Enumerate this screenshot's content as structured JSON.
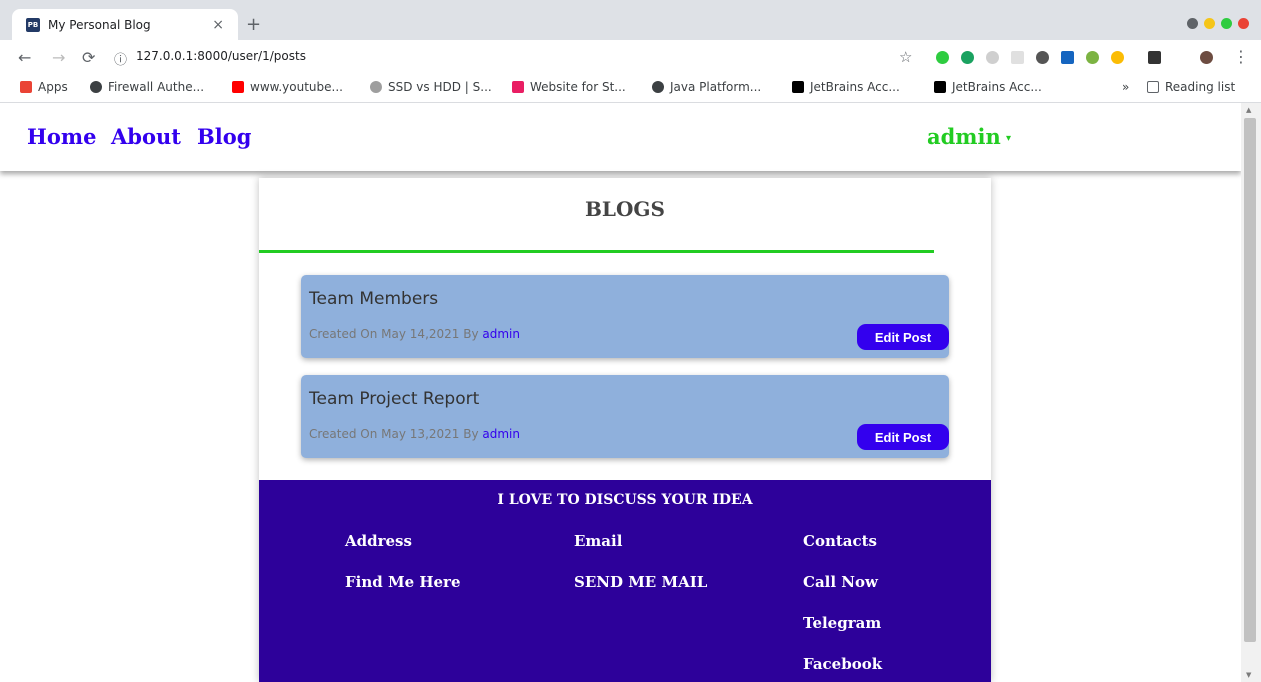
{
  "browser": {
    "tab_title": "My Personal Blog",
    "tab_favicon_text": "PB",
    "tab_close": "×",
    "new_tab": "+",
    "url": "127.0.0.1:8000/user/1/posts",
    "bookmarks": [
      "Apps",
      "Firewall Authe...",
      "www.youtube...",
      "SSD vs HDD | S...",
      "Website for St...",
      "Java Platform...",
      "JetBrains Acc...",
      "JetBrains Acc..."
    ],
    "bookmarks_more": "»",
    "reading_list": "Reading list"
  },
  "nav": {
    "home": "Home",
    "about": "About",
    "blog": "Blog",
    "user": "admin",
    "caret": "▾"
  },
  "main": {
    "title": "BLOGS",
    "posts": [
      {
        "title": "Team Members",
        "meta": "Created On May 14,2021 By ",
        "author": "admin",
        "edit_label": "Edit Post"
      },
      {
        "title": "Team Project Report",
        "meta": "Created On May 13,2021 By ",
        "author": "admin",
        "edit_label": "Edit Post"
      }
    ]
  },
  "footer": {
    "heading": "I LOVE TO DISCUSS YOUR IDEA",
    "col1": {
      "head": "Address",
      "item": "Find Me Here"
    },
    "col2": {
      "head": "Email",
      "item": "SEND ME MAIL"
    },
    "col3": {
      "head": "Contacts",
      "items": [
        "Call Now",
        "Telegram",
        "Facebook"
      ]
    }
  },
  "colors": {
    "nav_link": "#3300ee",
    "user": "#22cc22",
    "card_bg": "#8fb0dc",
    "button": "#3300ee",
    "footer_bg": "#2d019a"
  }
}
